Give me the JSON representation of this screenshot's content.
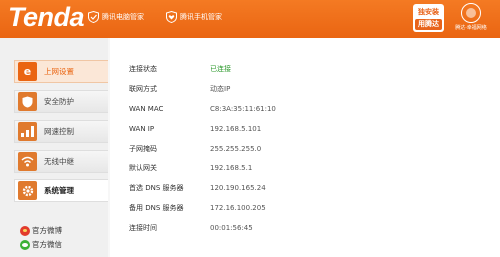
{
  "header": {
    "logo": "Tenda",
    "brand_links": [
      "腾讯电脑管家",
      "腾讯手机管家"
    ],
    "promo": {
      "line1": "独安装",
      "line2": "用腾达"
    },
    "badge_caption": "腾达·幸福网络"
  },
  "sidebar": {
    "items": [
      {
        "label": "上网设置",
        "icon": "e-icon"
      },
      {
        "label": "安全防护",
        "icon": "shield-icon"
      },
      {
        "label": "网速控制",
        "icon": "signal-bars-icon"
      },
      {
        "label": "无线中继",
        "icon": "wireless-relay-icon"
      },
      {
        "label": "系统管理",
        "icon": "gear-icon"
      }
    ],
    "social": [
      {
        "label": "官方微博",
        "icon": "weibo-icon"
      },
      {
        "label": "官方微信",
        "icon": "wechat-icon"
      }
    ]
  },
  "status": {
    "rows": [
      {
        "label": "连接状态",
        "value": "已连接"
      },
      {
        "label": "联网方式",
        "value": "动态IP"
      },
      {
        "label": "WAN MAC",
        "value": "C8:3A:35:11:61:10"
      },
      {
        "label": "WAN IP",
        "value": "192.168.5.101"
      },
      {
        "label": "子网掩码",
        "value": "255.255.255.0"
      },
      {
        "label": "默认网关",
        "value": "192.168.5.1"
      },
      {
        "label": "首选 DNS 服务器",
        "value": "120.190.165.24"
      },
      {
        "label": "备用 DNS 服务器",
        "value": "172.16.100.205"
      },
      {
        "label": "连接时间",
        "value": "00:01:56:45"
      }
    ]
  },
  "colors": {
    "brand_orange": "#ea6512",
    "connected_green": "#2e9a2e"
  }
}
